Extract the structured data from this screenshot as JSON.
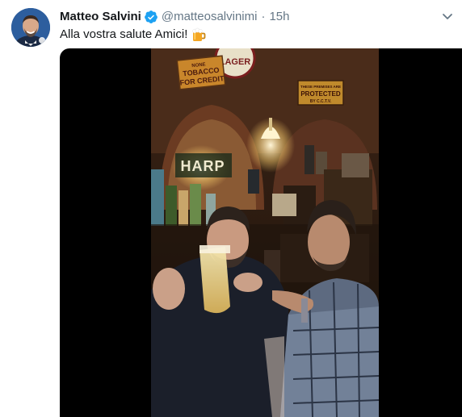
{
  "tweet": {
    "author_name": "Matteo Salvini",
    "author_handle": "@matteosalvinimi",
    "separator": "·",
    "timestamp": "15h",
    "text": "Alla vostra salute Amici!"
  },
  "icons": {
    "verified": "verified-badge-icon",
    "emoji": "beer-mug-emoji-icon",
    "menu": "chevron-down-icon",
    "avatar": "profile-photo"
  },
  "media": {
    "type": "video",
    "signs": {
      "top_sign": "LAGER",
      "left_sign_line1": "NONE",
      "left_sign_line2": "TOBACCO",
      "left_sign_line3": "FOR CREDIT",
      "right_sign_line1": "THESE PREMISES ARE",
      "right_sign_line2": "PROTECTED",
      "right_sign_line3": "BY C.C.T.V.",
      "bar_sign": "HARP"
    }
  },
  "colors": {
    "name": "#14171a",
    "secondary": "#657786",
    "verified": "#1da1f2",
    "media_background": "#000000"
  }
}
